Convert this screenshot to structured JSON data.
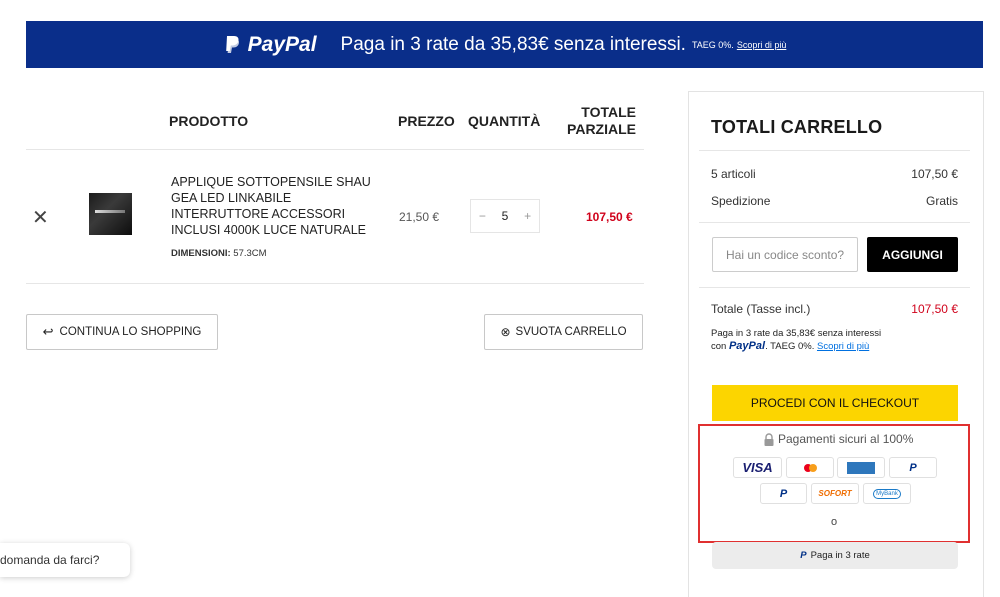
{
  "banner": {
    "brand": "PayPal",
    "message": "Paga in 3 rate da 35,83€ senza interessi.",
    "taeg": "TAEG 0%.",
    "link": "Scopri di più"
  },
  "cart": {
    "columns": {
      "product": "PRODOTTO",
      "price": "PREZZO",
      "quantity": "QUANTITÀ",
      "subtotal_line1": "TOTALE",
      "subtotal_line2": "PARZIALE"
    },
    "remove_icon": "close-icon",
    "item": {
      "name": "APPLIQUE SOTTOPENSILE SHAU GEA LED LINKABILE INTERRUTTORE ACCESSORI INCLUSI 4000K LUCE NATURALE",
      "dim_label": "DIMENSIONI:",
      "dim_value": "57.3CM",
      "price": "21,50 €",
      "qty_minus": "−",
      "qty_value": "5",
      "qty_plus": "+",
      "subtotal": "107,50 €"
    },
    "continue_label": "CONTINUA LO SHOPPING",
    "empty_label": "SVUOTA CARRELLO"
  },
  "totals": {
    "title": "TOTALI CARRELLO",
    "items_label": "5 articoli",
    "items_value": "107,50 €",
    "shipping_label": "Spedizione",
    "shipping_value": "Gratis",
    "coupon_placeholder": "Hai un codice sconto?",
    "coupon_button": "AGGIUNGI",
    "total_label": "Totale (Tasse incl.)",
    "total_value": "107,50 €",
    "pp_line1": "Paga in 3 rate da 35,83€ senza interessi",
    "pp_con": "con",
    "pp_brand": "PayPal",
    "pp_taeg": ". TAEG 0%.",
    "pp_link": "Scopri di più",
    "checkout": "PROCEDI CON IL CHECKOUT",
    "secure": "Pagamenti sicuri al 100%",
    "icons": {
      "visa": "VISA",
      "sofort": "SOFORT",
      "mybank": "MyBank"
    },
    "o_text": "o",
    "pay3": "Paga in 3 rate"
  },
  "chat": {
    "text": "domanda da farci?"
  },
  "colors": {
    "banner": "#0a2e8a",
    "accent_red": "#d0021b",
    "checkout_yellow": "#fcd500"
  }
}
